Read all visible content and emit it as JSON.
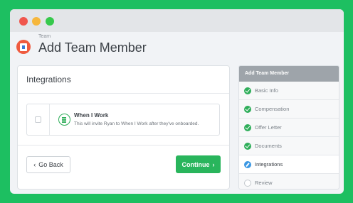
{
  "window": {
    "controls": [
      "close",
      "minimize",
      "maximize"
    ]
  },
  "header": {
    "breadcrumb": "Team",
    "title": "Add Team Member",
    "icon": "team-icon"
  },
  "card": {
    "title": "Integrations",
    "integration": {
      "name": "When I Work",
      "description": "This will invite Ryan to When I Work after they've onboarded.",
      "checked": false
    },
    "back_label": "Go Back",
    "continue_label": "Continue"
  },
  "sidebar": {
    "title": "Add Team Member",
    "steps": [
      {
        "label": "Basic Info",
        "status": "done"
      },
      {
        "label": "Compensation",
        "status": "done"
      },
      {
        "label": "Offer Letter",
        "status": "done"
      },
      {
        "label": "Documents",
        "status": "done"
      },
      {
        "label": "Integrations",
        "status": "current"
      },
      {
        "label": "Review",
        "status": "pending"
      }
    ]
  },
  "colors": {
    "background": "#1dbf61",
    "accent": "#29b55c",
    "current": "#3a97e3"
  }
}
